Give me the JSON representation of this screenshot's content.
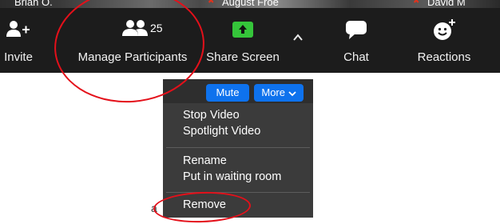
{
  "video_strip": {
    "names": [
      "Brian O.",
      "August Froe",
      "David M"
    ]
  },
  "toolbar": {
    "invite": {
      "label": "Invite",
      "icon": "add-person-icon"
    },
    "participants": {
      "label": "Manage Participants",
      "count": "25",
      "icon": "participants-icon"
    },
    "share": {
      "label": "Share Screen",
      "icon": "share-screen-arrow-icon",
      "color": "#35c53a"
    },
    "chat": {
      "label": "Chat",
      "icon": "chat-bubble-icon"
    },
    "reactions": {
      "label": "Reactions",
      "icon": "smiley-plus-icon"
    },
    "caret_icon": "chevron-up-icon"
  },
  "participant_menu": {
    "mute_label": "Mute",
    "more_label": "More",
    "items": [
      "Stop Video",
      "Spotlight Video",
      "Rename",
      "Put in waiting room",
      "Remove"
    ],
    "edge_text": "a"
  },
  "colors": {
    "highlight": "#e4101a",
    "accent": "#0e72ed",
    "toolbar_bg": "#1c1c1c"
  }
}
